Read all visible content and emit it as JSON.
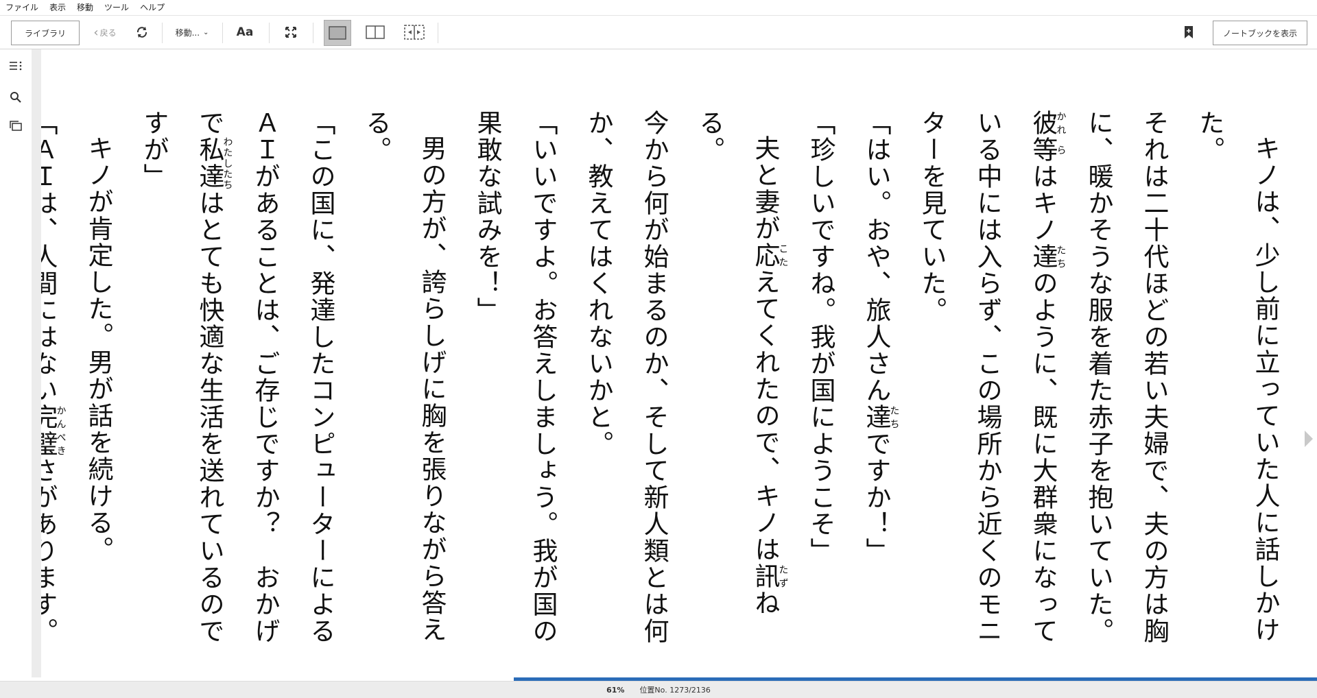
{
  "menu": [
    "ファイル",
    "表示",
    "移動",
    "ツール",
    "ヘルプ"
  ],
  "toolbar": {
    "library_label": "ライブラリ",
    "back_label": "戻る",
    "goto_label": "移動...",
    "font_label": "Aa",
    "notebook_label": "ノートブックを表示"
  },
  "reading": {
    "paragraphs": [
      {
        "indent": true,
        "text": "キノは、少し前に立っていた人に話しかけた。"
      },
      {
        "indent": false,
        "text": "それは二十代ほどの若い夫婦で、夫の方は胸に、暖かそうな服を着た赤子を抱いていた。彼等はキノ達のように、既に大群衆になっている中には入らず、この場所から近くのモニターを見ていた。"
      },
      {
        "indent": false,
        "text": "「はい。おや、旅人さん達ですか！」"
      },
      {
        "indent": false,
        "text": "「珍しいですね。我が国にようこそ」"
      },
      {
        "indent": true,
        "text": "夫と妻が応えてくれたので、キノは訊ねる。"
      },
      {
        "indent": false,
        "text": "今から何が始まるのか、そして新人類とは何か、教えてはくれないかと。"
      },
      {
        "indent": false,
        "text": "「いいですよ。お答えしましょう。我が国の果敢な試みを！」"
      },
      {
        "indent": true,
        "text": "男の方が、誇らしげに胸を張りながら答える。"
      },
      {
        "indent": false,
        "text": "「この国に、発達したコンピューターによるＡＩがあることは、ご存じですか？　おかげで私達はとても快適な生活を送れているのですが」"
      },
      {
        "indent": true,
        "text": "キノが肯定した。男が話を続ける。"
      },
      {
        "indent": false,
        "text": "「ＡＩは、人間にはない完璧さがあります。そこで私達は考えました。〝果たして、ＡＩに人の教育は可能だろうか？〟と」"
      }
    ]
  },
  "ruby": [
    {
      "base": "彼",
      "reading": "かれ"
    },
    {
      "base": "等",
      "reading": "ら"
    },
    {
      "base": "達",
      "reading": "たち"
    },
    {
      "base": "応",
      "reading": "こた"
    },
    {
      "base": "訊",
      "reading": "たず"
    },
    {
      "base": "私達",
      "reading": "わたしたち"
    },
    {
      "base": "完璧",
      "reading": "かんぺき"
    }
  ],
  "status": {
    "percent": "61%",
    "location": "位置No. 1273/2136",
    "progress_fraction": 0.61
  },
  "icons": {
    "toc": "toc-icon",
    "search": "search-icon",
    "flashcards": "flashcards-icon",
    "refresh": "refresh-icon",
    "fullscreen": "fullscreen-icon",
    "bookmark": "bookmark-icon"
  },
  "colors": {
    "progress": "#2b6cb8",
    "active_view": "#c6c6c6"
  }
}
